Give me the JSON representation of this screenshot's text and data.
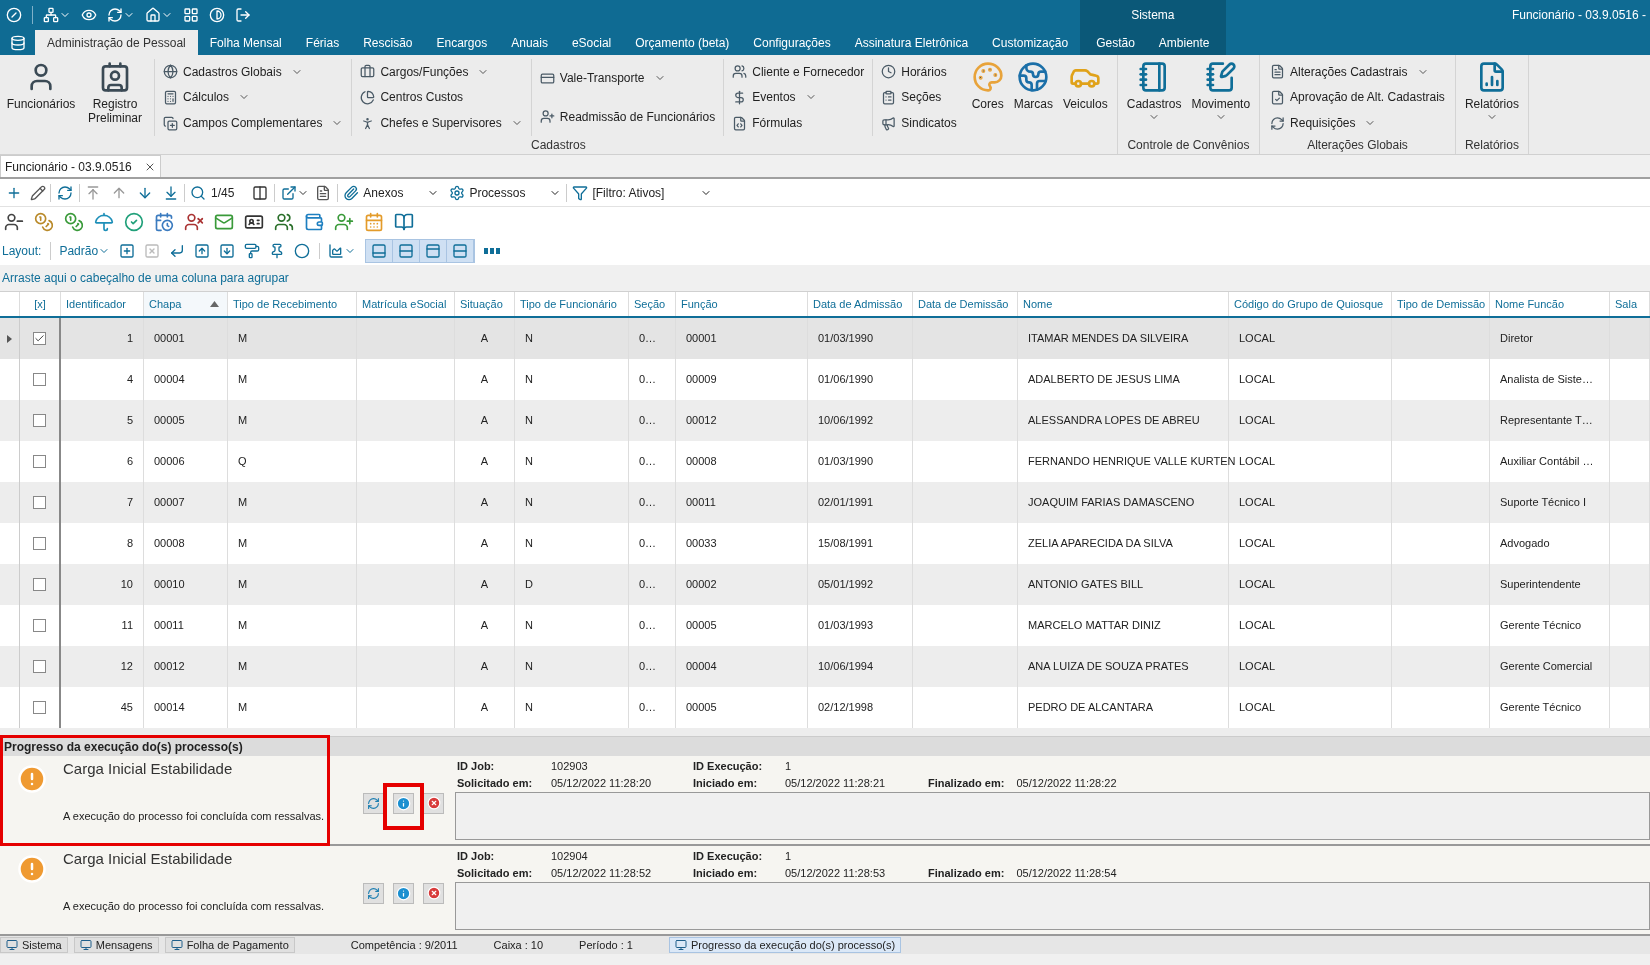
{
  "title_bar": {
    "context_label": "Sistema",
    "window_title": "Funcionário - 03.9.0516 -"
  },
  "menu_tabs": [
    {
      "label": "Administração de Pessoal",
      "selected": true,
      "kind": "normal"
    },
    {
      "label": "Folha Mensal",
      "selected": false,
      "kind": "normal"
    },
    {
      "label": "Férias",
      "selected": false,
      "kind": "normal"
    },
    {
      "label": "Rescisão",
      "selected": false,
      "kind": "normal"
    },
    {
      "label": "Encargos",
      "selected": false,
      "kind": "normal"
    },
    {
      "label": "Anuais",
      "selected": false,
      "kind": "normal"
    },
    {
      "label": "eSocial",
      "selected": false,
      "kind": "normal"
    },
    {
      "label": "Orçamento (beta)",
      "selected": false,
      "kind": "normal"
    },
    {
      "label": "Configurações",
      "selected": false,
      "kind": "normal"
    },
    {
      "label": "Assinatura Eletrônica",
      "selected": false,
      "kind": "normal"
    },
    {
      "label": "Customização",
      "selected": false,
      "kind": "normal"
    },
    {
      "label": "Gestão",
      "selected": false,
      "kind": "context"
    },
    {
      "label": "Ambiente",
      "selected": false,
      "kind": "context"
    }
  ],
  "ribbon_groups": [
    {
      "label": "Cadastros",
      "sections": [
        {
          "kind": "large",
          "items": [
            {
              "label": "Funcionários",
              "dropdown": false
            },
            {
              "label": "Registro Preliminar",
              "dropdown": false
            }
          ]
        },
        {
          "kind": "column",
          "items": [
            {
              "label": "Cadastros Globais",
              "dropdown": true
            },
            {
              "label": "Cálculos",
              "dropdown": true
            },
            {
              "label": "Campos Complementares",
              "dropdown": true
            }
          ]
        },
        {
          "kind": "column",
          "items": [
            {
              "label": "Cargos/Funções",
              "dropdown": true
            },
            {
              "label": "Centros Custos",
              "dropdown": false
            },
            {
              "label": "Chefes e Supervisores",
              "dropdown": true
            }
          ]
        },
        {
          "kind": "column",
          "items": [
            {
              "label": "Vale-Transporte",
              "dropdown": true
            },
            {
              "label": "Readmissão de Funcionários",
              "dropdown": false
            }
          ]
        },
        {
          "kind": "column",
          "items": [
            {
              "label": "Cliente e Fornecedor",
              "dropdown": false
            },
            {
              "label": "Eventos",
              "dropdown": true
            },
            {
              "label": "Fórmulas",
              "dropdown": false
            }
          ]
        },
        {
          "kind": "column",
          "items": [
            {
              "label": "Horários",
              "dropdown": false
            },
            {
              "label": "Seções",
              "dropdown": false
            },
            {
              "label": "Sindicatos",
              "dropdown": false
            }
          ]
        },
        {
          "kind": "large",
          "items": [
            {
              "label": "Cores",
              "dropdown": false
            },
            {
              "label": "Marcas",
              "dropdown": false
            },
            {
              "label": "Veiculos",
              "dropdown": false
            }
          ]
        }
      ]
    },
    {
      "label": "Controle de Convênios",
      "sections": [
        {
          "kind": "large",
          "items": [
            {
              "label": "Cadastros",
              "dropdown": true
            },
            {
              "label": "Movimento",
              "dropdown": true
            }
          ]
        }
      ]
    },
    {
      "label": "Alterações Globais",
      "sections": [
        {
          "kind": "column",
          "items": [
            {
              "label": "Alterações Cadastrais",
              "dropdown": true
            },
            {
              "label": "Aprovação de Alt. Cadastrais",
              "dropdown": false
            },
            {
              "label": "Requisições",
              "dropdown": true
            }
          ]
        }
      ]
    },
    {
      "label": "Relatórios",
      "sections": [
        {
          "kind": "large",
          "items": [
            {
              "label": "Relatórios",
              "dropdown": true
            }
          ]
        }
      ]
    }
  ],
  "document_tab": {
    "label": "Funcionário - 03.9.0516"
  },
  "toolbar": {
    "record_position": "1/45",
    "attachments": "Anexos",
    "processes": "Processos",
    "filter": "[Filtro: Ativos]"
  },
  "layout_bar": {
    "label": "Layout:",
    "layout": "Padrão"
  },
  "group_hint": "Arraste aqui o cabeçalho de uma coluna para agrupar",
  "table": {
    "columns": [
      {
        "label": "[x]",
        "sorted": false
      },
      {
        "label": "Identificador",
        "sorted": false
      },
      {
        "label": "Chapa",
        "sorted": true
      },
      {
        "label": "Tipo de Recebimento",
        "sorted": false
      },
      {
        "label": "Matrícula eSocial",
        "sorted": false
      },
      {
        "label": "Situação",
        "sorted": false
      },
      {
        "label": "Tipo de Funcionário",
        "sorted": false
      },
      {
        "label": "Seção",
        "sorted": false
      },
      {
        "label": "Função",
        "sorted": false
      },
      {
        "label": "Data de Admissão",
        "sorted": false
      },
      {
        "label": "Data de Demissão",
        "sorted": false
      },
      {
        "label": "Nome",
        "sorted": false
      },
      {
        "label": "Código do Grupo de Quiosque",
        "sorted": false
      },
      {
        "label": "Tipo de Demissão",
        "sorted": false
      },
      {
        "label": "Nome Funcão",
        "sorted": false
      },
      {
        "label": "Sala",
        "sorted": false
      }
    ],
    "rows": [
      {
        "selected": true,
        "checked": true,
        "identificador": "1",
        "chapa": "00001",
        "tipo_recebimento": "M",
        "situacao": "A",
        "tipo_funcionario": "N",
        "secao": "0…",
        "funcao": "00001",
        "data_admissao": "01/03/1990",
        "nome": "ITAMAR MENDES DA SILVEIRA",
        "codigo_grupo_quiosque": "LOCAL",
        "nome_funcao": "Diretor"
      },
      {
        "selected": false,
        "checked": false,
        "identificador": "4",
        "chapa": "00004",
        "tipo_recebimento": "M",
        "situacao": "A",
        "tipo_funcionario": "N",
        "secao": "0…",
        "funcao": "00009",
        "data_admissao": "01/06/1990",
        "nome": "ADALBERTO DE JESUS LIMA",
        "codigo_grupo_quiosque": "LOCAL",
        "nome_funcao": "Analista de Siste…"
      },
      {
        "selected": false,
        "checked": false,
        "identificador": "5",
        "chapa": "00005",
        "tipo_recebimento": "M",
        "situacao": "A",
        "tipo_funcionario": "N",
        "secao": "0…",
        "funcao": "00012",
        "data_admissao": "10/06/1992",
        "nome": "ALESSANDRA LOPES DE ABREU",
        "codigo_grupo_quiosque": "LOCAL",
        "nome_funcao": "Representante T…"
      },
      {
        "selected": false,
        "checked": false,
        "identificador": "6",
        "chapa": "00006",
        "tipo_recebimento": "Q",
        "situacao": "A",
        "tipo_funcionario": "N",
        "secao": "0…",
        "funcao": "00008",
        "data_admissao": "01/03/1990",
        "nome": "FERNANDO HENRIQUE VALLE KURTEN",
        "codigo_grupo_quiosque": "LOCAL",
        "nome_funcao": "Auxiliar Contábil …"
      },
      {
        "selected": false,
        "checked": false,
        "identificador": "7",
        "chapa": "00007",
        "tipo_recebimento": "M",
        "situacao": "A",
        "tipo_funcionario": "N",
        "secao": "0…",
        "funcao": "00011",
        "data_admissao": "02/01/1991",
        "nome": "JOAQUIM FARIAS DAMASCENO",
        "codigo_grupo_quiosque": "LOCAL",
        "nome_funcao": "Suporte Técnico I"
      },
      {
        "selected": false,
        "checked": false,
        "identificador": "8",
        "chapa": "00008",
        "tipo_recebimento": "M",
        "situacao": "A",
        "tipo_funcionario": "N",
        "secao": "0…",
        "funcao": "00033",
        "data_admissao": "15/08/1991",
        "nome": "ZELIA APARECIDA DA SILVA",
        "codigo_grupo_quiosque": "LOCAL",
        "nome_funcao": "Advogado"
      },
      {
        "selected": false,
        "checked": false,
        "identificador": "10",
        "chapa": "00010",
        "tipo_recebimento": "M",
        "situacao": "A",
        "tipo_funcionario": "D",
        "secao": "0…",
        "funcao": "00002",
        "data_admissao": "05/01/1992",
        "nome": "ANTONIO GATES BILL",
        "codigo_grupo_quiosque": "LOCAL",
        "nome_funcao": "Superintendente"
      },
      {
        "selected": false,
        "checked": false,
        "identificador": "11",
        "chapa": "00011",
        "tipo_recebimento": "M",
        "situacao": "A",
        "tipo_funcionario": "N",
        "secao": "0…",
        "funcao": "00005",
        "data_admissao": "01/03/1993",
        "nome": "MARCELO MATTAR DINIZ",
        "codigo_grupo_quiosque": "LOCAL",
        "nome_funcao": "Gerente Técnico"
      },
      {
        "selected": false,
        "checked": false,
        "identificador": "12",
        "chapa": "00012",
        "tipo_recebimento": "M",
        "situacao": "A",
        "tipo_funcionario": "N",
        "secao": "0…",
        "funcao": "00004",
        "data_admissao": "10/06/1994",
        "nome": "ANA LUIZA  DE SOUZA PRATES",
        "codigo_grupo_quiosque": "LOCAL",
        "nome_funcao": "Gerente Comercial"
      },
      {
        "selected": false,
        "checked": false,
        "identificador": "45",
        "chapa": "00014",
        "tipo_recebimento": "M",
        "situacao": "A",
        "tipo_funcionario": "N",
        "secao": "0…",
        "funcao": "00005",
        "data_admissao": "02/12/1998",
        "nome": "PEDRO DE ALCANTARA",
        "codigo_grupo_quiosque": "LOCAL",
        "nome_funcao": "Gerente Técnico"
      }
    ]
  },
  "progress_panel": {
    "title": "Progresso da execução do(s) processo(s)",
    "jobs": [
      {
        "title": "Carga Inicial Estabilidade",
        "message": "A execução do processo foi concluída com ressalvas.",
        "highlighted": true,
        "info_highlighted": true,
        "fields": [
          {
            "label": "ID Job:",
            "value": "102903"
          },
          {
            "label": "ID Execução:",
            "value": "1"
          },
          {
            "label": "Solicitado em:",
            "value": "05/12/2022 11:28:20"
          },
          {
            "label": "Iniciado em:",
            "value": "05/12/2022 11:28:21"
          },
          {
            "label": "Finalizado em:",
            "value": "05/12/2022 11:28:22"
          }
        ]
      },
      {
        "title": "Carga Inicial Estabilidade",
        "message": "A execução do processo foi concluída com ressalvas.",
        "highlighted": false,
        "info_highlighted": false,
        "fields": [
          {
            "label": "ID Job:",
            "value": "102904"
          },
          {
            "label": "ID Execução:",
            "value": "1"
          },
          {
            "label": "Solicitado em:",
            "value": "05/12/2022 11:28:52"
          },
          {
            "label": "Iniciado em:",
            "value": "05/12/2022 11:28:53"
          },
          {
            "label": "Finalizado em:",
            "value": "05/12/2022 11:28:54"
          }
        ]
      }
    ]
  },
  "status_bar": {
    "tabs_left": [
      {
        "label": "Sistema",
        "selected": false
      },
      {
        "label": "Mensagens",
        "selected": false
      },
      {
        "label": "Folha de Pagamento",
        "selected": false
      }
    ],
    "info": [
      "Competência : 9/2011",
      "Caixa : 10",
      "Período : 1"
    ],
    "tabs_right": [
      {
        "label": "Progresso da execução do(s) processo(s)",
        "selected": true
      }
    ]
  }
}
